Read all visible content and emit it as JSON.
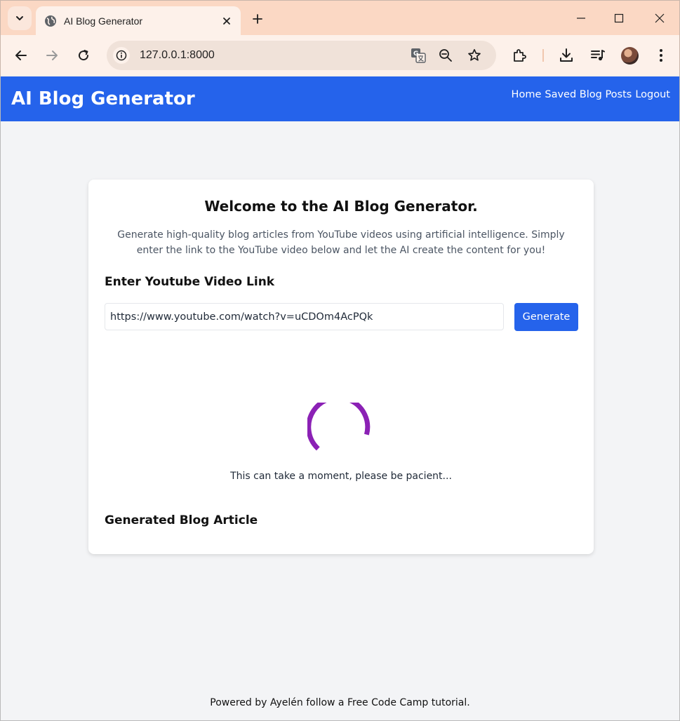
{
  "browser": {
    "tab_title": "AI Blog Generator",
    "url": "127.0.0.1:8000",
    "accent": "#fbd8c4"
  },
  "header": {
    "title": "AI Blog Generator",
    "color": "#2563eb",
    "nav": [
      {
        "label": "Home"
      },
      {
        "label": "Saved Blog Posts"
      },
      {
        "label": "Logout"
      }
    ]
  },
  "card": {
    "title": "Welcome to the AI Blog Generator.",
    "description": "Generate high-quality blog articles from YouTube videos using artificial intelligence. Simply enter the link to the YouTube video below and let the AI create the content for you!",
    "input_label": "Enter Youtube Video Link",
    "input_value": "https://www.youtube.com/watch?v=uCDOm4AcPQk",
    "generate_label": "Generate",
    "loading_message": "This can take a moment, please be pacient...",
    "spinner_color": "#8b21b5",
    "article_heading": "Generated Blog Article"
  },
  "footer": {
    "text": "Powered by Ayelén follow a Free Code Camp tutorial."
  }
}
